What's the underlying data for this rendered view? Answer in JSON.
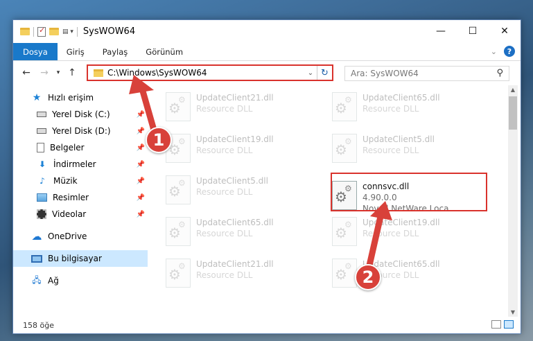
{
  "window": {
    "title": "SysWOW64",
    "controls": {
      "minimize": "—",
      "maximize": "☐",
      "close": "✕"
    }
  },
  "ribbon": {
    "tabs": [
      "Dosya",
      "Giriş",
      "Paylaş",
      "Görünüm"
    ],
    "help": "?"
  },
  "address": {
    "path": "C:\\Windows\\SysWOW64",
    "search_placeholder": "Ara: SysWOW64"
  },
  "nav": {
    "quick_access": "Hızlı erişim",
    "items": [
      {
        "label": "Yerel Disk (C:)",
        "icon": "drive-icon"
      },
      {
        "label": "Yerel Disk (D:)",
        "icon": "drive-icon"
      },
      {
        "label": "Belgeler",
        "icon": "document-icon"
      },
      {
        "label": "İndirmeler",
        "icon": "download-icon"
      },
      {
        "label": "Müzik",
        "icon": "music-icon"
      },
      {
        "label": "Resimler",
        "icon": "pictures-icon"
      },
      {
        "label": "Videolar",
        "icon": "video-icon"
      }
    ],
    "onedrive": "OneDrive",
    "this_pc": "Bu bilgisayar",
    "network": "Ağ"
  },
  "files": [
    {
      "name": "UpdateClient21.dll",
      "desc": "Resource DLL",
      "col": 0,
      "row": 0
    },
    {
      "name": "UpdateClient65.dll",
      "desc": "Resource DLL",
      "col": 1,
      "row": 0
    },
    {
      "name": "UpdateClient19.dll",
      "desc": "Resource DLL",
      "col": 0,
      "row": 1
    },
    {
      "name": "UpdateClient5.dll",
      "desc": "Resource DLL",
      "col": 1,
      "row": 1
    },
    {
      "name": "UpdateClient5.dll",
      "desc": "Resource DLL",
      "col": 0,
      "row": 2
    },
    {
      "name": "UpdateClient65.dll",
      "desc": "Resource DLL",
      "col": 0,
      "row": 3
    },
    {
      "name": "UpdateClient19.dll",
      "desc": "Resource DLL",
      "col": 1,
      "row": 3
    },
    {
      "name": "UpdateClient21.dll",
      "desc": "Resource DLL",
      "col": 0,
      "row": 4
    },
    {
      "name": "UpdateClient65.dll",
      "desc": "Resource DLL",
      "col": 1,
      "row": 4
    }
  ],
  "selected_file": {
    "name": "connsvc.dll",
    "version": "4.90.0.0",
    "company": "Novell NetWare Loca..."
  },
  "status": {
    "count": "158 öğe"
  },
  "annotations": {
    "step1": "1",
    "step2": "2",
    "color": "#d8413a"
  }
}
